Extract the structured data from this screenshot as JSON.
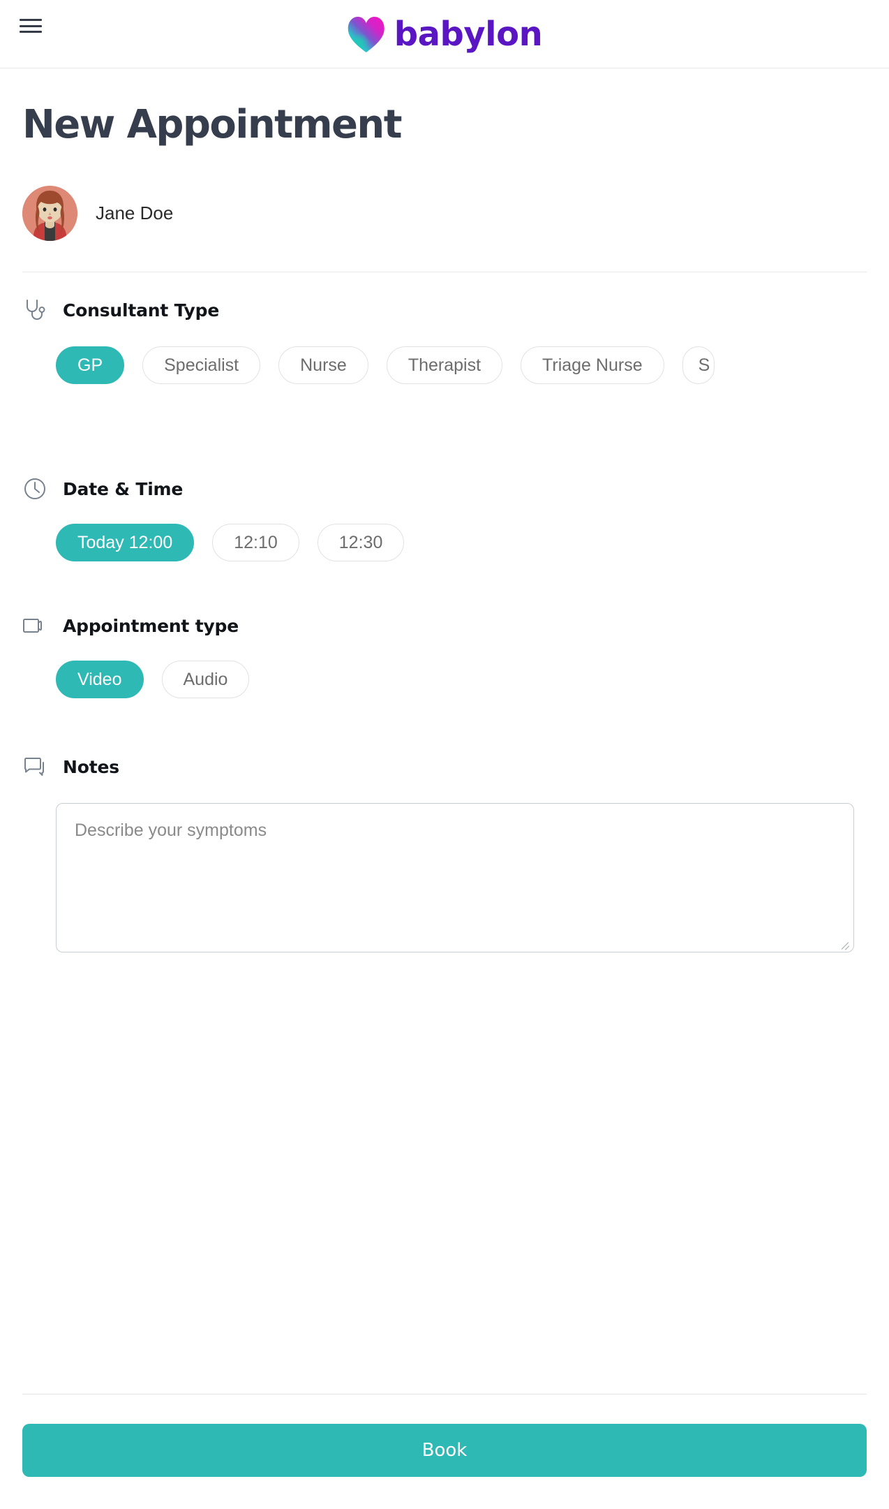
{
  "header": {
    "menu_label": "Menu",
    "brand_name": "babylon",
    "brand_colors": {
      "word": "#5B16C4",
      "heart_cyan": "#19C0D6",
      "heart_purple": "#7B4FD0",
      "heart_magenta": "#ED1EC0"
    }
  },
  "page": {
    "title": "New Appointment"
  },
  "patient": {
    "name": "Jane Doe",
    "avatar_alt": "Jane Doe avatar",
    "avatar_colors": {
      "background": "#DE8876",
      "hair": "#9E4A2E",
      "skin": "#E8D4B4",
      "jacket": "#C63D3B",
      "top": "#3B3B3B"
    }
  },
  "sections": {
    "consultant": {
      "icon": "stethoscope-icon",
      "title": "Consultant Type",
      "selected": "GP",
      "options": [
        {
          "label": "GP",
          "selected": true
        },
        {
          "label": "Specialist",
          "selected": false
        },
        {
          "label": "Nurse",
          "selected": false
        },
        {
          "label": "Therapist",
          "selected": false
        },
        {
          "label": "Triage Nurse",
          "selected": false
        },
        {
          "label": "S",
          "selected": false,
          "truncated": true
        }
      ]
    },
    "datetime": {
      "icon": "clock-icon",
      "title": "Date & Time",
      "selected": "Today 12:00",
      "options": [
        {
          "label": "Today 12:00",
          "selected": true
        },
        {
          "label": "12:10",
          "selected": false
        },
        {
          "label": "12:30",
          "selected": false
        }
      ]
    },
    "appointment_type": {
      "icon": "video-camera-icon",
      "title": "Appointment type",
      "selected": "Video",
      "options": [
        {
          "label": "Video",
          "selected": true
        },
        {
          "label": "Audio",
          "selected": false
        }
      ]
    },
    "notes": {
      "icon": "chat-bubbles-icon",
      "title": "Notes",
      "placeholder": "Describe your symptoms",
      "value": ""
    }
  },
  "footer": {
    "book_label": "Book",
    "accent_color": "#2FB9B5"
  }
}
